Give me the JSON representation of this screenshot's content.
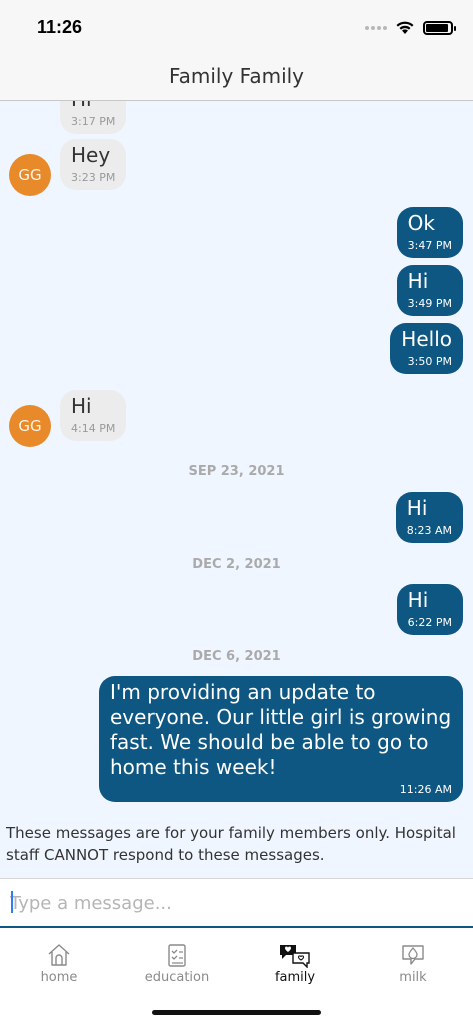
{
  "status_bar": {
    "time": "11:26",
    "battery_level": 0.9
  },
  "header": {
    "title": "Family Family"
  },
  "messages": [
    {
      "dir": "in",
      "text": "Hi",
      "time": "3:17 PM"
    },
    {
      "dir": "in",
      "avatar": "GG",
      "text": "Hey",
      "time": "3:23 PM"
    },
    {
      "dir": "out",
      "text": "Ok",
      "time": "3:47 PM"
    },
    {
      "dir": "out",
      "text": "Hi",
      "time": "3:49 PM"
    },
    {
      "dir": "out",
      "text": "Hello",
      "time": "3:50 PM"
    },
    {
      "dir": "in",
      "avatar": "GG",
      "text": "Hi",
      "time": "4:14 PM"
    },
    {
      "dir": "out",
      "text": "Hi",
      "time": "8:23 AM"
    },
    {
      "dir": "out",
      "text": "Hi",
      "time": "6:22 PM"
    },
    {
      "dir": "out",
      "text": "I'm providing an update to everyone. Our little girl is growing fast. We should be able to go to home this week!",
      "time": "11:26 AM"
    }
  ],
  "date_separators": [
    "SEP 23, 2021",
    "DEC 2, 2021",
    "DEC 6, 2021"
  ],
  "disclaimer": "These messages are for your family members only. Hospital staff CANNOT respond to these messages.",
  "composer": {
    "placeholder": "Type a message..."
  },
  "tabs": [
    {
      "label": "home",
      "icon": "home-icon"
    },
    {
      "label": "education",
      "icon": "checklist-icon"
    },
    {
      "label": "family",
      "icon": "chat-bubbles-icon",
      "active": true
    },
    {
      "label": "milk",
      "icon": "milk-drop-icon"
    }
  ],
  "colors": {
    "outgoing_bubble": "#0e5783",
    "incoming_bubble": "#ececec",
    "avatar": "#e8892a",
    "chat_background": "#f0f6ff"
  }
}
